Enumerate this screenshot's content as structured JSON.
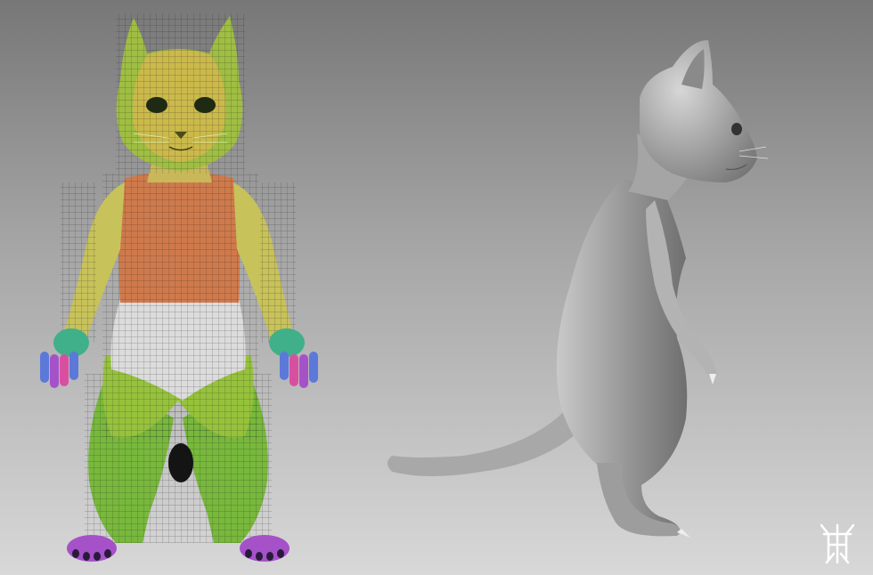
{
  "scene": {
    "background_top": "#777777",
    "background_bottom": "#d8d8d8",
    "front_model": {
      "head_color": "#9fbe43",
      "head_uv_color": "#d2b94c",
      "chest_color": "#cf7a4c",
      "belly_color": "#dcdcdc",
      "leg_color": "#78b83c",
      "arm_color": "#c8c25a",
      "paw_colors": [
        "#3fb08a",
        "#5b79d8",
        "#a552c9",
        "#d94fa0"
      ]
    },
    "side_model": {
      "clay_color": "#a8a8a8"
    },
    "logo": {
      "icon": "artist-monogram-icon"
    }
  }
}
